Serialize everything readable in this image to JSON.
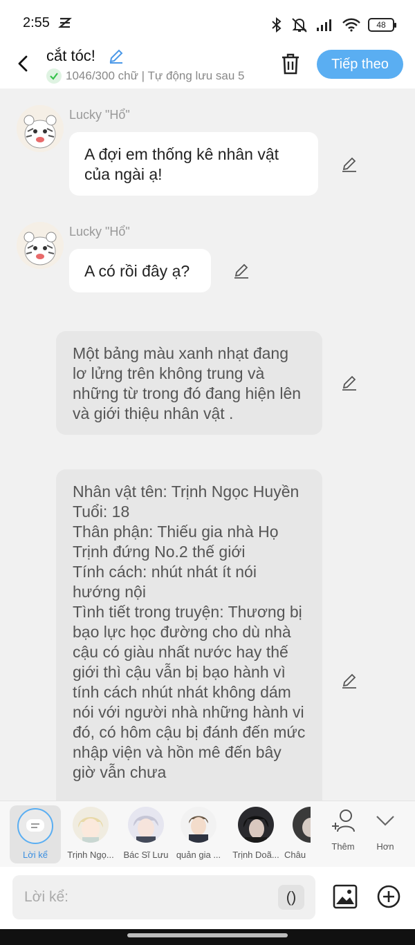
{
  "status_bar": {
    "time": "2:55",
    "battery": "48"
  },
  "header": {
    "title": "cắt tóc!",
    "subtitle": "1046/300 chữ | Tự động lưu sau 5",
    "next_label": "Tiếp theo"
  },
  "messages": [
    {
      "sender": "Lucky \"Hổ\"",
      "text": "A đợi em thống kê nhân vật của ngài ạ!"
    },
    {
      "sender": "Lucky \"Hổ\"",
      "text": "A có rồi đây ạ?"
    }
  ],
  "narrations": [
    {
      "text": "Một bảng màu xanh nhạt đang lơ lửng trên không trung và những từ trong đó đang hiện lên và giới thiệu nhân vật ."
    },
    {
      "lines": [
        "Nhân vật tên: Trịnh Ngọc Huyền",
        "Tuổi: 18",
        "Thân phận: Thiếu gia nhà Họ Trịnh đứng No.2 thế giới",
        "Tính cách: nhút nhát ít nói hướng nội",
        "Tình tiết trong truyện: Thương bị bạo lực học đường cho dù nhà cậu có giàu nhất nước hay thế giới thì cậu vẫn bị bạo hành vì tính cách nhút nhát không dám nói với người nhà những hành vi đó, có hôm cậu bị đánh đến mức nhập viện và hồn mê đến bây giờ vẫn chưa"
      ]
    }
  ],
  "character_bar": {
    "narrator_label": "Lời kể",
    "characters": [
      "Trịnh Ngọ...",
      "Bác Sĩ Lưu",
      "quản gia ...",
      "Trịnh Doã...",
      "Châu"
    ],
    "add_label": "Thêm",
    "more_label": "Hơn"
  },
  "input": {
    "placeholder": "Lời kể:",
    "paren_label": "()"
  },
  "colors": {
    "accent": "#5aaef2",
    "background": "#f1f1f1",
    "narration_bg": "#e7e7e7"
  }
}
